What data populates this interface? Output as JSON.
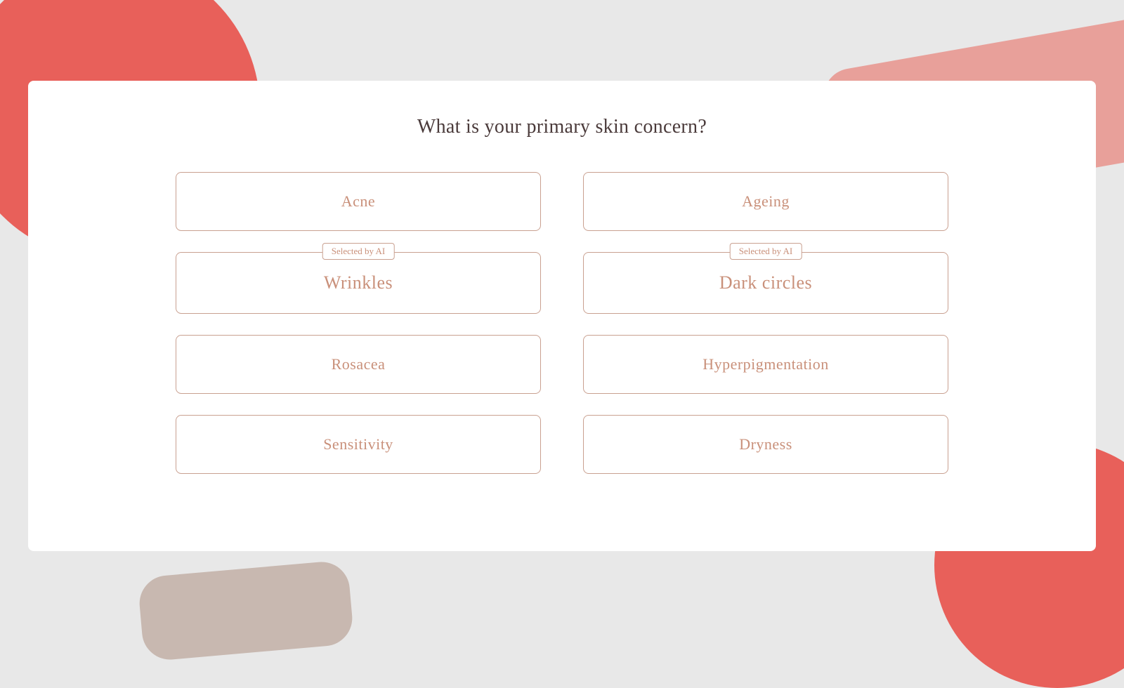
{
  "background": {
    "color": "#e8e8e8",
    "accent_red": "#e8605a",
    "accent_pink": "#e8a09a",
    "accent_taupe": "#c8b8b0"
  },
  "page": {
    "title": "What is your primary skin concern?"
  },
  "options": [
    {
      "id": "acne",
      "label": "Acne",
      "selected": false,
      "ai_selected": false
    },
    {
      "id": "ageing",
      "label": "Ageing",
      "selected": false,
      "ai_selected": false
    },
    {
      "id": "wrinkles",
      "label": "Wrinkles",
      "selected": true,
      "ai_selected": true,
      "ai_label": "Selected by AI"
    },
    {
      "id": "dark-circles",
      "label": "Dark circles",
      "selected": true,
      "ai_selected": true,
      "ai_label": "Selected by AI"
    },
    {
      "id": "rosacea",
      "label": "Rosacea",
      "selected": false,
      "ai_selected": false
    },
    {
      "id": "hyperpigmentation",
      "label": "Hyperpigmentation",
      "selected": false,
      "ai_selected": false
    },
    {
      "id": "sensitivity",
      "label": "Sensitivity",
      "selected": false,
      "ai_selected": false
    },
    {
      "id": "dryness",
      "label": "Dryness",
      "selected": false,
      "ai_selected": false
    }
  ]
}
